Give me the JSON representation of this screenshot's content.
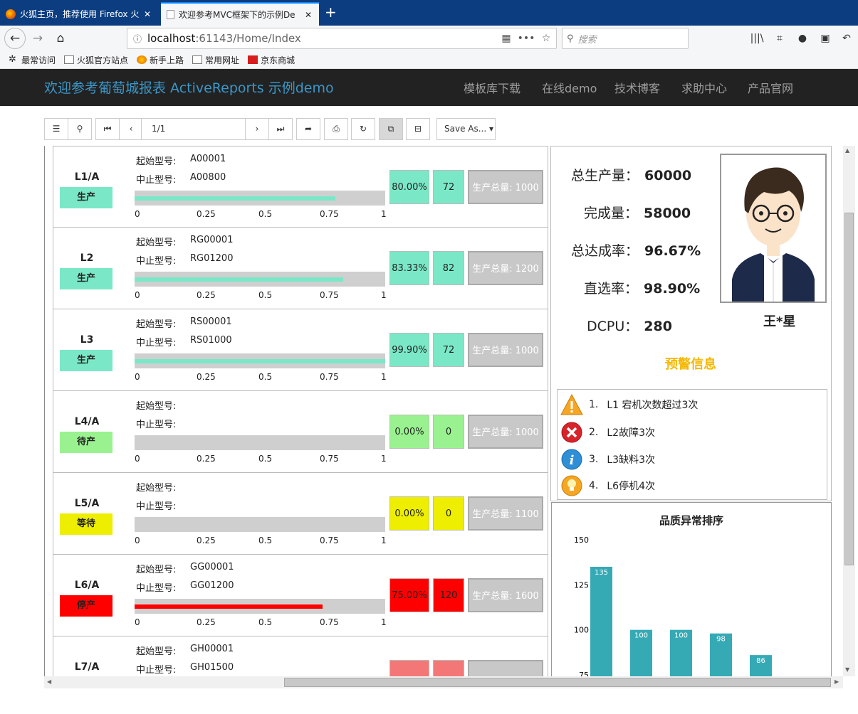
{
  "browser": {
    "tabs": [
      {
        "title": "火狐主页，推荐使用 Firefox 火"
      },
      {
        "title": "欢迎参考MVC框架下的示例De"
      }
    ],
    "new_tab": "+",
    "url_host": "localhost",
    "url_rest": ":61143/Home/Index",
    "search_placeholder": "搜索",
    "bookmarks": [
      "最常访问",
      "火狐官方站点",
      "新手上路",
      "常用网址",
      "京东商城"
    ]
  },
  "site": {
    "brand": "欢迎参考葡萄城报表 ActiveReports 示例demo",
    "nav": [
      "模板库下载",
      "在线demo",
      "技术博客",
      "求助中心",
      "产品官网"
    ]
  },
  "toolbar": {
    "page": "1/1",
    "save_as": "Save As..."
  },
  "lines": {
    "start_label": "起始型号:",
    "end_label": "中止型号:",
    "ticks": [
      "0",
      "0.25",
      "0.5",
      "0.75",
      "1"
    ],
    "rows": [
      {
        "name": "L1/A",
        "status": "生产",
        "start": "A00001",
        "end": "A00800",
        "pct": "80.00%",
        "progress": 0.8,
        "count": "72",
        "total": "生产总量: 1000",
        "color": "#7ae8c6"
      },
      {
        "name": "L2",
        "status": "生产",
        "start": "RG00001",
        "end": "RG01200",
        "pct": "83.33%",
        "progress": 0.8333,
        "count": "82",
        "total": "生产总量: 1200",
        "color": "#7ae8c6"
      },
      {
        "name": "L3",
        "status": "生产",
        "start": "RS00001",
        "end": "RS01000",
        "pct": "99.90%",
        "progress": 0.999,
        "count": "72",
        "total": "生产总量: 1000",
        "color": "#7ae8c6"
      },
      {
        "name": "L4/A",
        "status": "待产",
        "start": "",
        "end": "",
        "pct": "0.00%",
        "progress": 0,
        "count": "0",
        "total": "生产总量: 1000",
        "color": "#99f28f"
      },
      {
        "name": "L5/A",
        "status": "等待",
        "start": "",
        "end": "",
        "pct": "0.00%",
        "progress": 0,
        "count": "0",
        "total": "生产总量: 1100",
        "color": "#eeee00"
      },
      {
        "name": "L6/A",
        "status": "停产",
        "start": "GG00001",
        "end": "GG01200",
        "pct": "75.00%",
        "progress": 0.75,
        "count": "120",
        "total": "生产总量: 1600",
        "color": "#ff0000"
      },
      {
        "name": "L7/A",
        "status": "",
        "start": "GH00001",
        "end": "GH01500",
        "pct": "",
        "progress": 0,
        "count": "",
        "total": "",
        "color": "#f47777"
      }
    ]
  },
  "summary": {
    "total_label": "总生产量：",
    "total_value": "60000",
    "done_label": "完成量：",
    "done_value": "58000",
    "rate_label": "总达成率：",
    "rate_value": "96.67%",
    "direct_label": "直选率：",
    "direct_value": "98.90%",
    "dcpu_label": "DCPU：",
    "dcpu_value": "280",
    "person_name": "王*星",
    "warning_title": "预警信息",
    "warnings": [
      {
        "num": "1.",
        "text": "L1 宕机次数超过3次",
        "icon": "warning-triangle-icon"
      },
      {
        "num": "2.",
        "text": "L2故障3次",
        "icon": "error-x-icon"
      },
      {
        "num": "3.",
        "text": "L3缺料3次",
        "icon": "info-icon"
      },
      {
        "num": "4.",
        "text": "L6停机4次",
        "icon": "lightbulb-icon"
      }
    ]
  },
  "chart_data": {
    "type": "bar",
    "title": "品质异常排序",
    "values": [
      135,
      100,
      100,
      98,
      86
    ],
    "yticks": [
      75,
      100,
      125,
      150
    ],
    "ylim": [
      75,
      150
    ],
    "bar_color": "#35aab5"
  }
}
